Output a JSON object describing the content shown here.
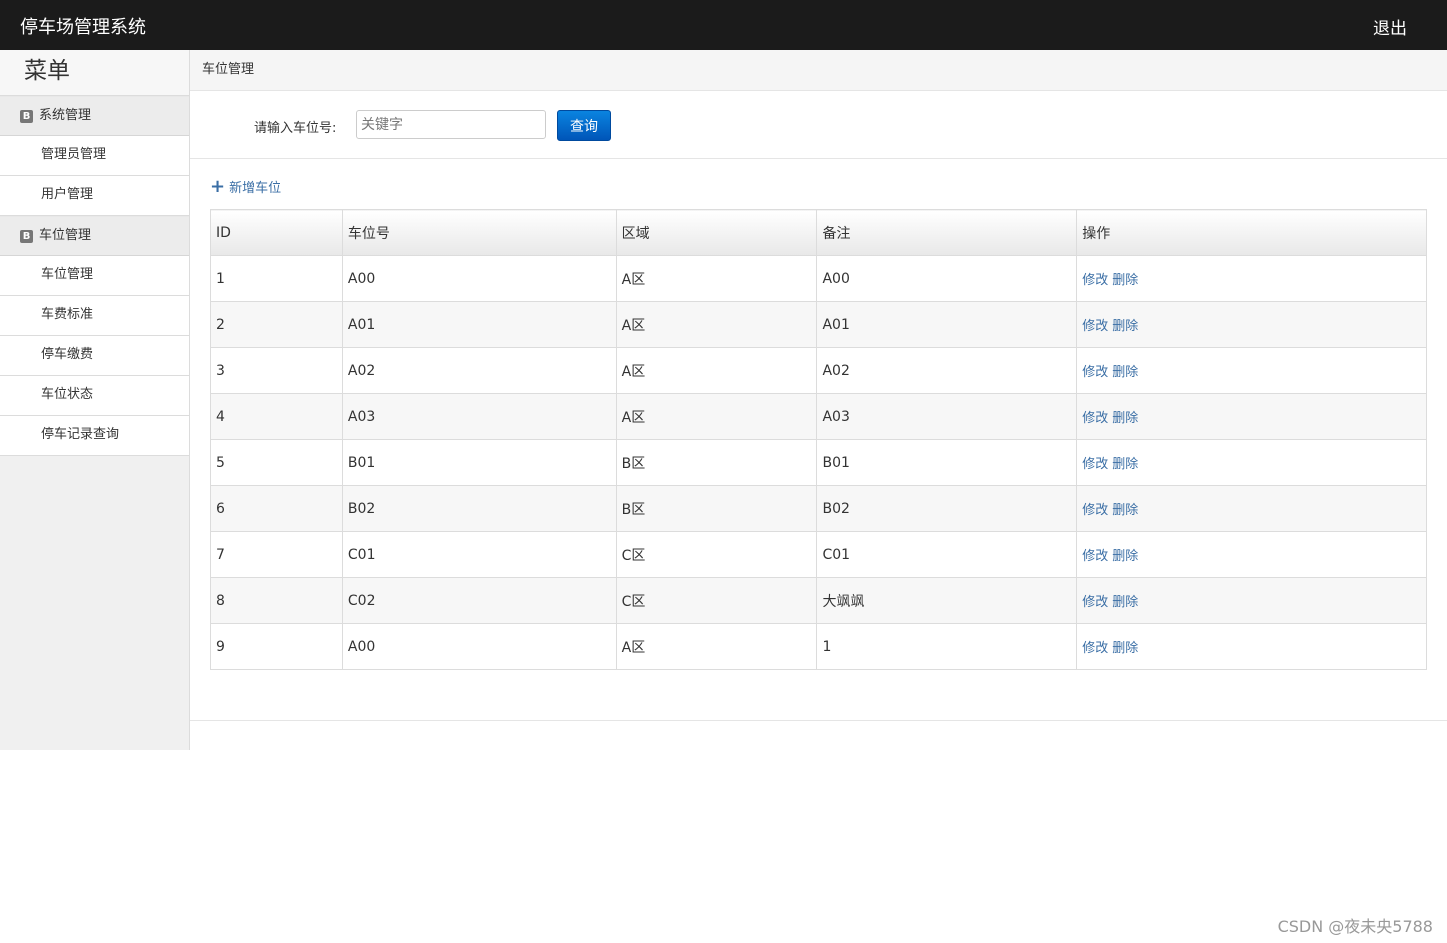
{
  "header": {
    "title": "停车场管理系统",
    "logout": "退出"
  },
  "sidebar": {
    "menu_title": "菜单",
    "groups": [
      {
        "label": "系统管理",
        "icon": "B",
        "items": [
          "管理员管理",
          "用户管理"
        ]
      },
      {
        "label": "车位管理",
        "icon": "B",
        "items": [
          "车位管理",
          "车费标准",
          "停车缴费",
          "车位状态",
          "停车记录查询"
        ]
      }
    ]
  },
  "breadcrumb": "车位管理",
  "search": {
    "label": "请输入车位号:",
    "placeholder": "关键字",
    "button": "查询"
  },
  "add_link": "新增车位",
  "table": {
    "headers": [
      "ID",
      "车位号",
      "区域",
      "备注",
      "操作"
    ],
    "rows": [
      [
        "1",
        "A00",
        "A区",
        "A00"
      ],
      [
        "2",
        "A01",
        "A区",
        "A01"
      ],
      [
        "3",
        "A02",
        "A区",
        "A02"
      ],
      [
        "4",
        "A03",
        "A区",
        "A03"
      ],
      [
        "5",
        "B01",
        "B区",
        "B01"
      ],
      [
        "6",
        "B02",
        "B区",
        "B02"
      ],
      [
        "7",
        "C01",
        "C区",
        "C01"
      ],
      [
        "8",
        "C02",
        "C区",
        "大飒飒"
      ],
      [
        "9",
        "A00",
        "A区",
        "1"
      ]
    ],
    "actions": {
      "edit": "修改",
      "delete": "删除"
    }
  },
  "watermark": "CSDN @夜未央5788",
  "colors": {
    "topbar": "#1b1b1b",
    "link": "#3a6ea5",
    "button": "#0a6fd1"
  }
}
